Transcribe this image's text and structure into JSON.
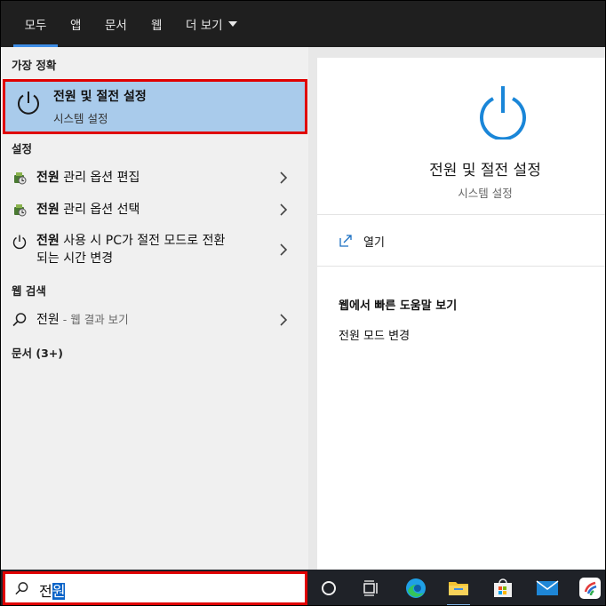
{
  "tabs": [
    {
      "label": "모두",
      "active": true
    },
    {
      "label": "앱"
    },
    {
      "label": "문서"
    },
    {
      "label": "웹"
    },
    {
      "label": "더 보기"
    }
  ],
  "best_match": {
    "heading": "가장 정확",
    "title": "전원 및 절전 설정",
    "subtitle": "시스템 설정",
    "icon": "power-icon"
  },
  "settings": {
    "heading": "설정",
    "items": [
      {
        "bold": "전원",
        "rest": " 관리 옵션 편집",
        "icon": "power-options-icon"
      },
      {
        "bold": "전원",
        "rest": " 관리 옵션 선택",
        "icon": "power-options-icon"
      },
      {
        "bold": "전원",
        "rest_line1": " 사용 시 PC가 절전 모드로 전환",
        "line2": "되는 시간 변경",
        "icon": "power-icon"
      }
    ]
  },
  "web": {
    "heading": "웹 검색",
    "query": "전원",
    "suffix": " - 웹 결과 보기",
    "icon": "search-icon"
  },
  "documents": {
    "heading": "문서 (3+)"
  },
  "detail": {
    "title": "전원 및 절전 설정",
    "subtitle": "시스템 설정",
    "open_label": "열기",
    "web_help_heading": "웹에서 빠른 도움말 보기",
    "web_help_link": "전원 모드 변경"
  },
  "taskbar": {
    "search_text_plain": "전",
    "search_text_selected": "원",
    "icons": [
      "cortana-icon",
      "task-view-icon",
      "edge-icon",
      "file-explorer-icon",
      "store-icon",
      "mail-icon",
      "app-icon"
    ]
  },
  "colors": {
    "accent": "#3d8de6",
    "selection_bg": "#a9cbeb",
    "highlight_border": "#e00000",
    "power_icon_blue": "#1a86d8"
  }
}
